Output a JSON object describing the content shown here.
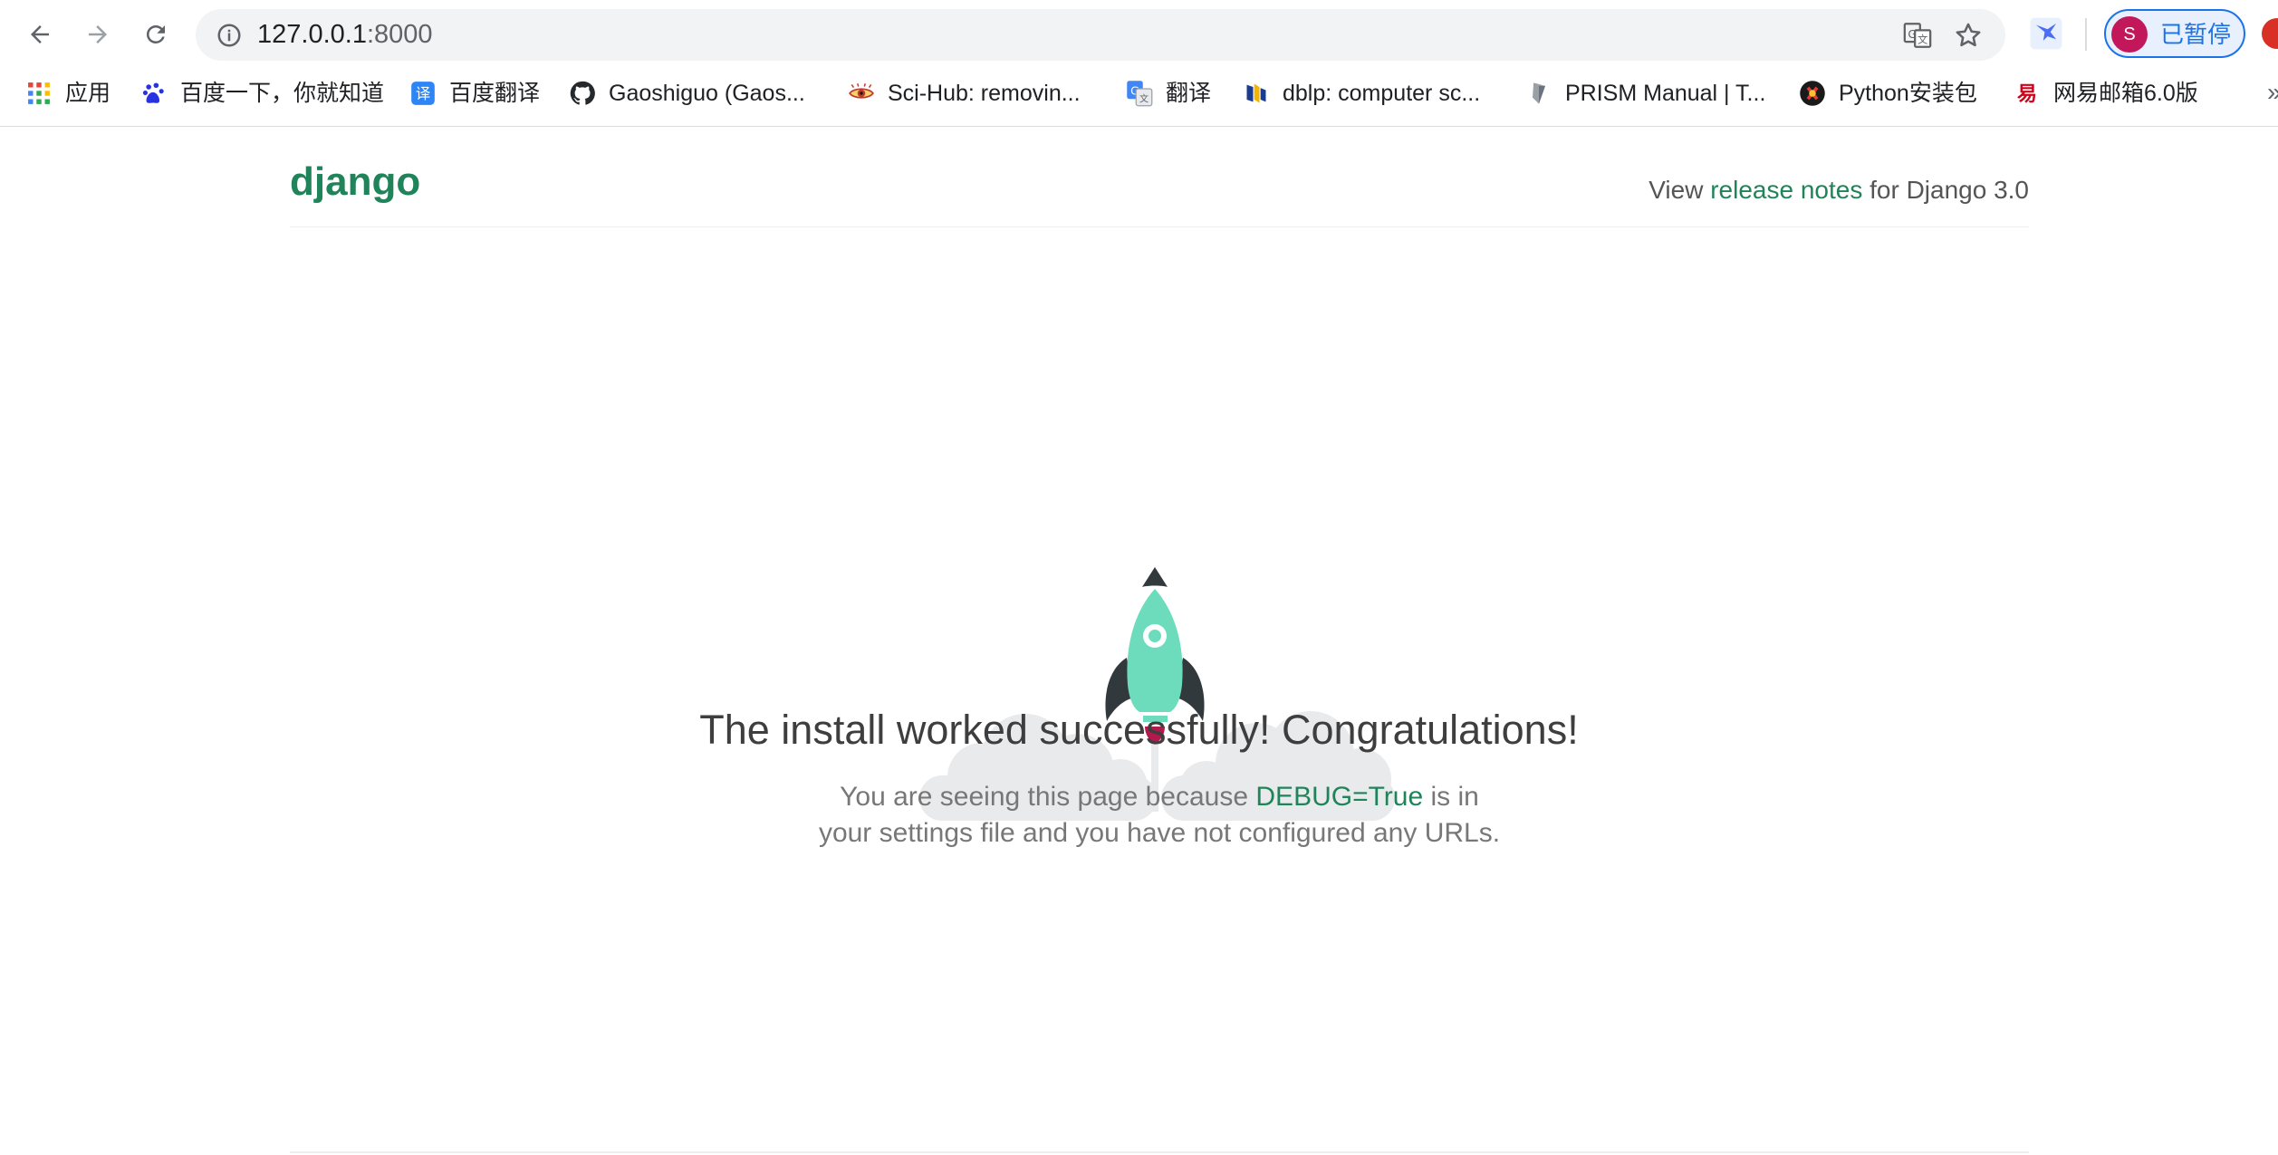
{
  "browser": {
    "url_host": "127.0.0.1",
    "url_port": ":8000",
    "profile_initial": "S",
    "profile_status": "已暂停",
    "colors": {
      "accent": "#1a73e8",
      "avatar": "#c2185b"
    }
  },
  "bookmarks": [
    {
      "label": "应用",
      "icon": "apps-grid-icon"
    },
    {
      "label": "百度一下，你就知道",
      "icon": "baidu-paw-icon"
    },
    {
      "label": "百度翻译",
      "icon": "baidu-translate-icon"
    },
    {
      "label": "Gaoshiguo (Gaos...",
      "icon": "github-icon"
    },
    {
      "label": "Sci-Hub: removin...",
      "icon": "scihub-eye-icon"
    },
    {
      "label": "翻译",
      "icon": "google-translate-icon"
    },
    {
      "label": "dblp: computer sc...",
      "icon": "dblp-icon"
    },
    {
      "label": "PRISM Manual | T...",
      "icon": "prism-icon"
    },
    {
      "label": "Python安装包",
      "icon": "python-red-icon"
    },
    {
      "label": "网易邮箱6.0版",
      "icon": "netease-mail-icon"
    }
  ],
  "page": {
    "logo": "django",
    "release_prefix": "View ",
    "release_link": "release notes",
    "release_suffix": " for Django 3.0",
    "headline": "The install worked successfully! Congratulations!",
    "body_prefix": "You are seeing this page because ",
    "body_debug": "DEBUG=True",
    "body_suffix": " is in your settings file and you have not configured any URLs.",
    "colors": {
      "django_green": "#20845a",
      "rocket": "#6ddcbd",
      "flame": "#b4184c"
    }
  }
}
